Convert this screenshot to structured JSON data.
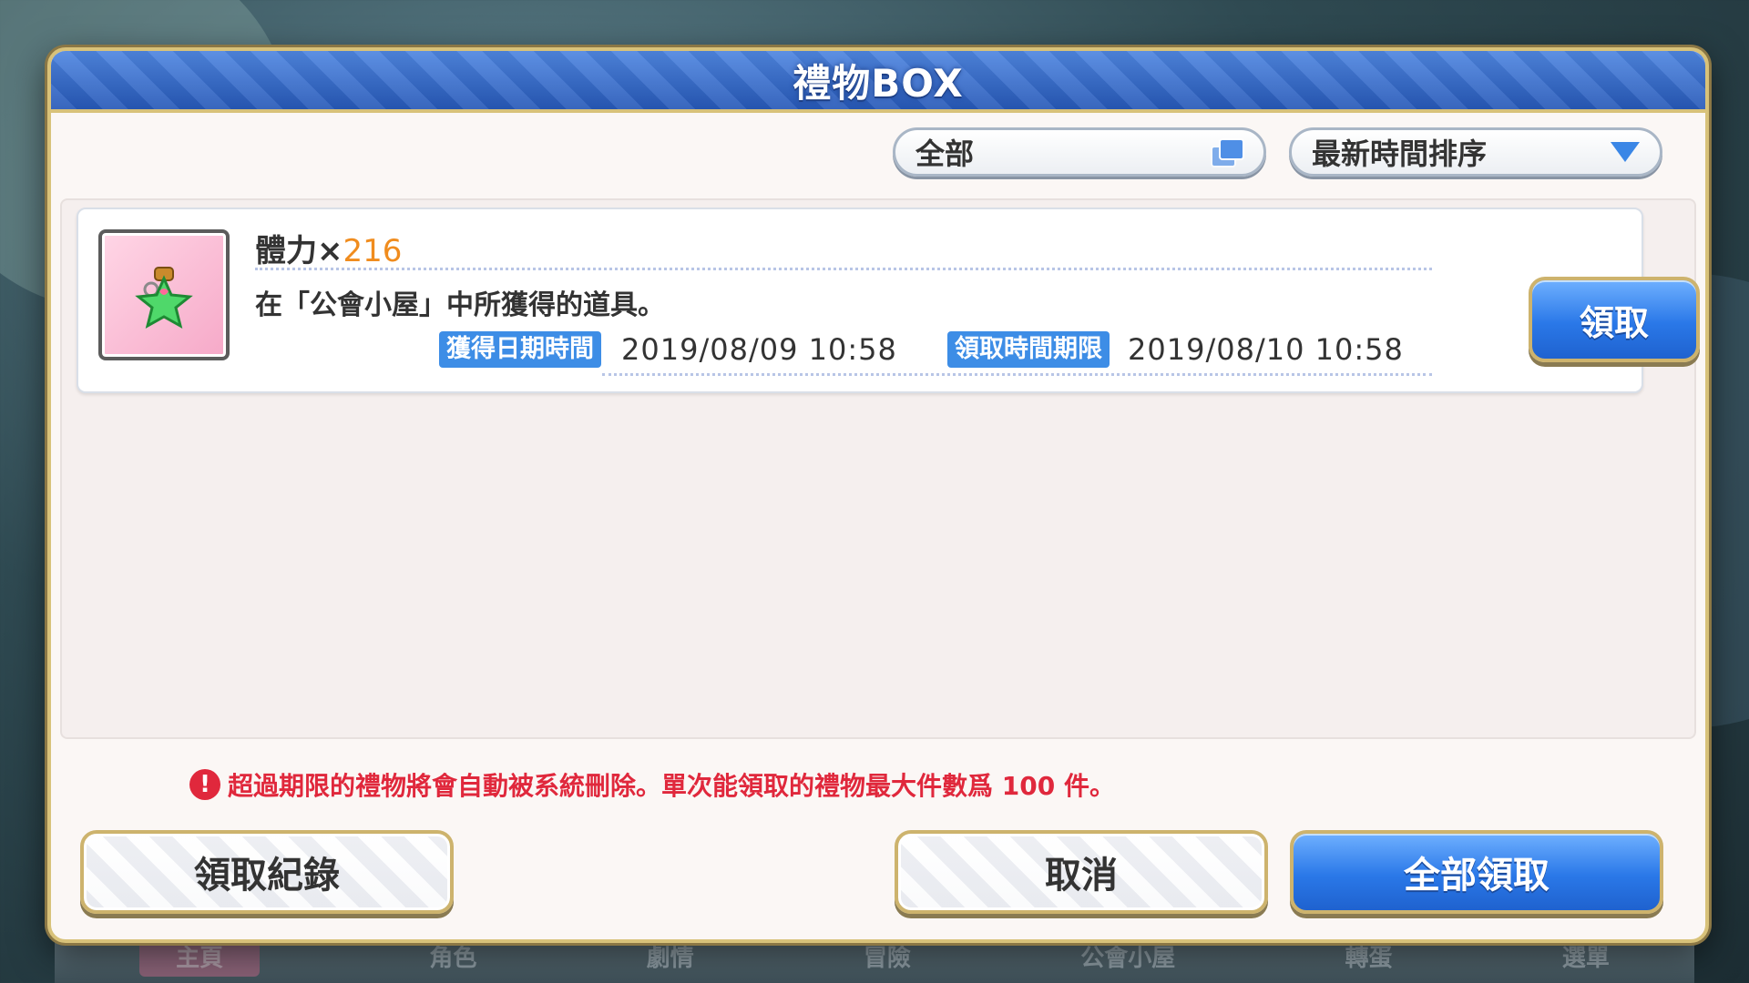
{
  "background_nav": {
    "items": [
      "主頁",
      "角色",
      "劇情",
      "冒險",
      "公會小屋",
      "轉蛋",
      "選單"
    ]
  },
  "dialog": {
    "title": "禮物BOX",
    "filter": {
      "selected": "全部",
      "icon": "copy-icon"
    },
    "sort": {
      "selected": "最新時間排序",
      "icon": "chevron-down-icon"
    },
    "gifts": [
      {
        "name": "體力×",
        "quantity": "216",
        "description": "在「公會小屋」中所獲得的道具。",
        "received_label": "獲得日期時間",
        "received_date": "2019/08/09 10:58",
        "deadline_label": "領取時間期限",
        "deadline_date": "2019/08/10 10:58",
        "button_label": "領取",
        "icon": "stamina-potion-icon"
      }
    ],
    "notice": "超過期限的禮物將會自動被系統刪除。單次能領取的禮物最大件數爲 100 件。",
    "buttons": {
      "history": "領取紀錄",
      "cancel": "取消",
      "receive_all": "全部領取"
    }
  },
  "colors": {
    "title_blue": "#2759b8",
    "accent_blue": "#3d8de6",
    "gold_border": "#d8c27a",
    "quantity_orange": "#f08c1e",
    "warning_red": "#e0283c"
  }
}
